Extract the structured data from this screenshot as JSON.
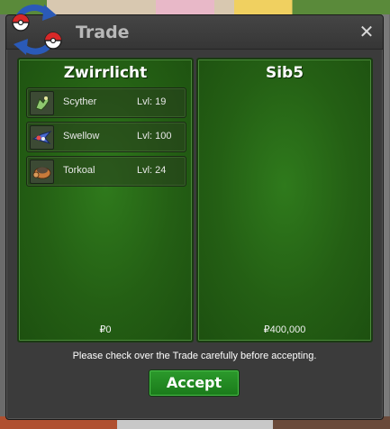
{
  "window": {
    "title": "Trade",
    "close_label": "✕"
  },
  "left_panel": {
    "name": "Zwirrlicht",
    "pokemon": [
      {
        "name": "Scyther",
        "level": "Lvl: 19",
        "icon": "scyther-icon",
        "color": "#6aa84f"
      },
      {
        "name": "Swellow",
        "level": "Lvl: 100",
        "icon": "swellow-icon",
        "color": "#4a6ab8"
      },
      {
        "name": "Torkoal",
        "level": "Lvl: 24",
        "icon": "torkoal-icon",
        "color": "#c07a3a"
      }
    ],
    "money": "₽0"
  },
  "right_panel": {
    "name": "Sib5",
    "money": "₽400,000"
  },
  "footer": {
    "notice": "Please check over the Trade carefully before accepting.",
    "accept_label": "Accept"
  }
}
